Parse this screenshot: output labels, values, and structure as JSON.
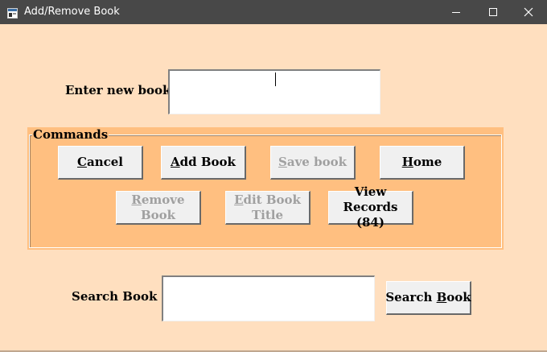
{
  "window": {
    "title": "Add/Remove Book",
    "controls": {
      "minimize": "minimize-icon",
      "maximize": "maximize-icon",
      "close": "close-icon"
    }
  },
  "form": {
    "new_book_label": "Enter new book",
    "new_book_value": "",
    "search_label": "Search Book",
    "search_value": ""
  },
  "commands": {
    "group_label": "Commands",
    "cancel": {
      "pre": "",
      "key": "C",
      "post": "ancel",
      "enabled": true
    },
    "add_book": {
      "pre": "",
      "key": "A",
      "post": "dd Book",
      "enabled": true
    },
    "save_book": {
      "pre": "",
      "key": "S",
      "post": "ave book",
      "enabled": false
    },
    "home": {
      "pre": "",
      "key": "H",
      "post": "ome",
      "enabled": true
    },
    "remove_book": {
      "pre": "",
      "key": "R",
      "post": "emove Book",
      "enabled": false
    },
    "edit_book_title": {
      "line1_pre": "",
      "line1_key": "E",
      "line1_post": "dit Book",
      "line2": "Title",
      "enabled": false
    },
    "view_records": {
      "line1": "View Records",
      "line2": "(84)",
      "enabled": true
    }
  },
  "search_button": {
    "pre": "Search ",
    "key": "B",
    "post": "ook"
  },
  "colors": {
    "form_background": "#ffdfbf",
    "group_background": "#ffbf80",
    "titlebar": "#484848",
    "button_face": "#f0f0f0",
    "disabled_text": "#a0a0a0"
  }
}
